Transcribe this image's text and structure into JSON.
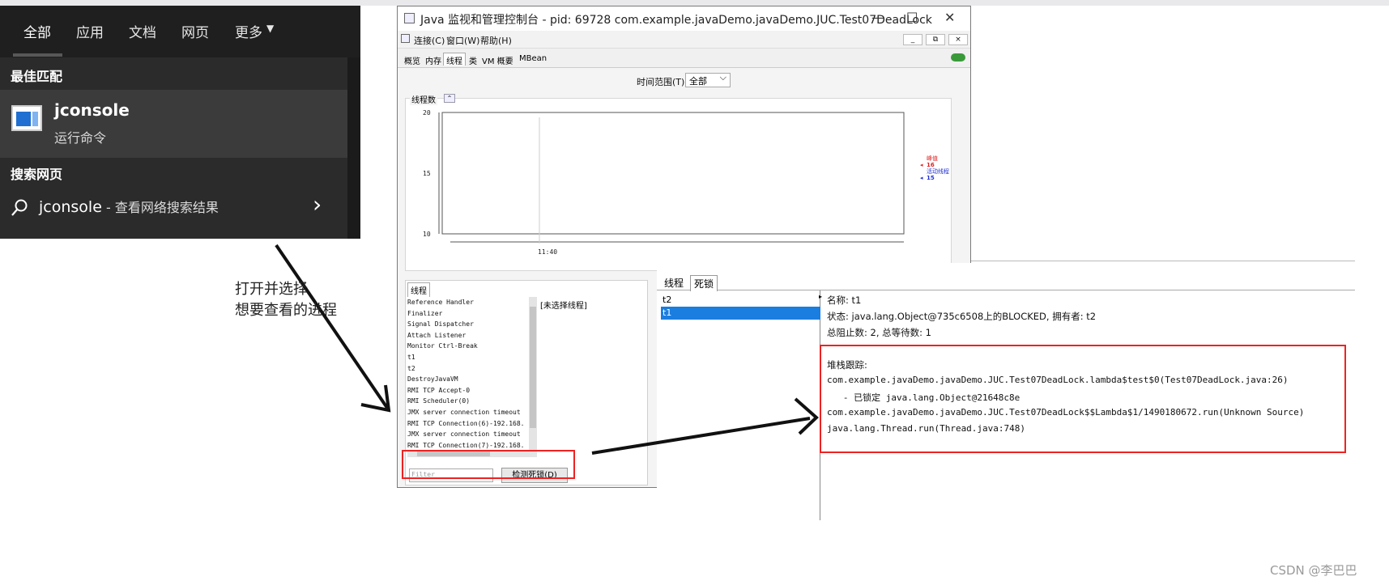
{
  "start_menu": {
    "tabs": [
      "全部",
      "应用",
      "文档",
      "网页",
      "更多"
    ],
    "more_arrow": "▼",
    "best_match_label": "最佳匹配",
    "best_match": {
      "name": "jconsole",
      "subtitle": "运行命令",
      "icon": "console-app-icon"
    },
    "web_section_label": "搜索网页",
    "web_result": {
      "query": "jconsole",
      "suffix": " - 查看网络搜索结果",
      "icon": "search-icon",
      "chevron": "›"
    }
  },
  "jconsole": {
    "title": "Java 监视和管理控制台 - pid: 69728 com.example.javaDemo.javaDemo.JUC.Test07DeadLock",
    "window_controls": [
      "—",
      "☐",
      "✕"
    ],
    "menu": [
      "连接(C)",
      "窗口(W)",
      "帮助(H)"
    ],
    "mdi_controls": [
      "_",
      "⧉",
      "×"
    ],
    "tabs": [
      "概览",
      "内存",
      "线程",
      "类",
      "VM 概要",
      "MBean"
    ],
    "active_tab": "线程",
    "time_range_label": "时间范围(T):",
    "time_range_value": "全部",
    "chart_panel_label": "线程数",
    "thread_panel_tab": "线程",
    "threads": [
      "Reference Handler",
      "Finalizer",
      "Signal Dispatcher",
      "Attach Listener",
      "Monitor Ctrl-Break",
      "t1",
      "t2",
      "DestroyJavaVM",
      "RMI TCP Accept-0",
      "RMI Scheduler(0)",
      "JMX server connection timeout",
      "RMI TCP Connection(6)-192.168.",
      "JMX server connection timeout",
      "RMI TCP Connection(7)-192.168."
    ],
    "no_selection": "[未选择线程]",
    "filter_placeholder": "Filter",
    "detect_button": "检测死锁(D)"
  },
  "chart_data": {
    "type": "line",
    "y_ticks": [
      "20",
      "15",
      "10"
    ],
    "x_ticks": [
      "11:40"
    ],
    "ylim": [
      10,
      20
    ],
    "legend": [
      {
        "label": "峰值",
        "value": "16",
        "color": "#e02020"
      },
      {
        "label": "活动线程",
        "value": "15",
        "color": "#2030d0"
      }
    ],
    "grid": false
  },
  "deadlock": {
    "tabs": [
      "线程",
      "死锁"
    ],
    "active_tab": "死锁",
    "threads": [
      "t2",
      "t1"
    ],
    "selected": "t1",
    "name_line": "名称: t1",
    "state_line": "状态: java.lang.Object@735c6508上的BLOCKED, 拥有者: t2",
    "counts_line": "总阻止数: 2, 总等待数: 1",
    "stack_label": "堆栈跟踪:",
    "stack": [
      "com.example.javaDemo.javaDemo.JUC.Test07DeadLock.lambda$test$0(Test07DeadLock.java:26)",
      "   - 已锁定 java.lang.Object@21648c8e",
      "com.example.javaDemo.javaDemo.JUC.Test07DeadLock$$Lambda$1/1490180672.run(Unknown Source)",
      "java.lang.Thread.run(Thread.java:748)"
    ]
  },
  "annotation": [
    "打开并选择",
    "想要查看的进程"
  ],
  "watermark": "CSDN @李巴巴",
  "colors": {
    "highlight_box": "#e22222",
    "selection": "#1a7de0",
    "start_bg": "#2b2b2b"
  }
}
